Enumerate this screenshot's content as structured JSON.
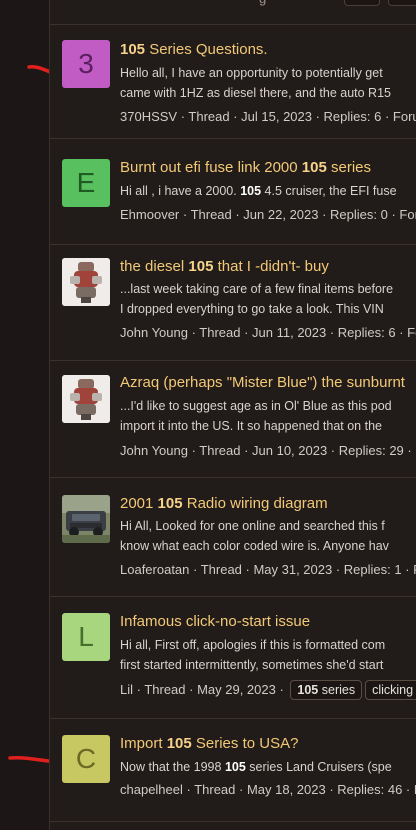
{
  "header": {
    "faint_text": "g"
  },
  "results": [
    {
      "avatar": {
        "letter": "3",
        "bg": "#c05cc4",
        "fg": "#5b1f60"
      },
      "title_bold": "105",
      "title_rest": " Series Questions.",
      "title_order": "bold-first",
      "snippet_line1": "Hello all, I have an opportunity to potentially get",
      "snippet_line2": "came with 1HZ as diesel there, and the auto R15",
      "meta": "370HSSV · Thread · Jul 15, 2023 · Replies: 6 · Foru"
    },
    {
      "avatar": {
        "letter": "E",
        "bg": "#59c05f",
        "fg": "#1f5b23"
      },
      "title_pre": "Burnt out efi fuse link 2000 ",
      "title_bold": "105",
      "title_post": " series",
      "snippet_pre": "Hi all , i have a 2000. ",
      "snippet_bold": "105",
      "snippet_post": " 4.5 cruiser, the EFI fuse",
      "meta": "Ehmoover · Thread · Jun 22, 2023 · Replies: 0 · Foru"
    },
    {
      "avatar": {
        "image": "engine-photo"
      },
      "title_pre": "the diesel ",
      "title_bold": "105",
      "title_post": " that I -didn't- buy",
      "snippet_line1": "...last week taking care of a few final items before",
      "snippet_line2": "I dropped everything to go take a look. This VIN",
      "meta": "John Young · Thread · Jun 11, 2023 · Replies: 6 · Fo"
    },
    {
      "avatar": {
        "image": "engine-photo"
      },
      "title": "Azraq (perhaps \"Mister Blue\") the sunburnt",
      "snippet_line1": "...I'd like to suggest age as in Ol' Blue as this pod",
      "snippet_line2": "import it into the US. It so happened that on the",
      "meta": "John Young · Thread · Jun 10, 2023 · Replies: 29 · F"
    },
    {
      "avatar": {
        "image": "truck-photo"
      },
      "title_pre": "2001 ",
      "title_bold": "105",
      "title_post": " Radio wiring diagram",
      "snippet_line1": "Hi All, Looked for one online and searched this f",
      "snippet_line2": "know what each color coded wire is. Anyone hav",
      "meta": "Loaferoatan · Thread · May 31, 2023 · Replies: 1 · F"
    },
    {
      "avatar": {
        "letter": "L",
        "bg": "#a8d67f",
        "fg": "#45702a"
      },
      "title": "Infamous click-no-start issue",
      "snippet_line1": "Hi all, First off, apologies if this is formatted com",
      "snippet_line2": "first started intermittently, sometimes she'd start",
      "meta": "Lil · Thread · May 29, 2023 · ",
      "tags": [
        {
          "bold": "105",
          "rest": " series"
        },
        {
          "bold": "",
          "rest": "clicking"
        }
      ]
    },
    {
      "avatar": {
        "letter": "C",
        "bg": "#c8c862",
        "fg": "#6a6a24"
      },
      "title_pre": "Import ",
      "title_bold": "105",
      "title_post": " Series to USA?",
      "snippet_pre": "Now that the 1998 ",
      "snippet_bold": "105",
      "snippet_post": " series Land Cruisers (spe",
      "meta": "chapelheel · Thread · May 18, 2023 · Replies: 46 · F"
    }
  ],
  "colors": {
    "accent_title": "#f2c976",
    "annotation_red": "#e0201c"
  }
}
